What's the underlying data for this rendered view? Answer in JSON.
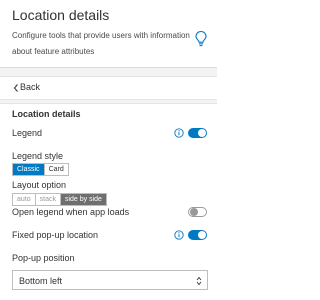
{
  "header": {
    "title": "Location details",
    "description": "Configure tools that provide users with information about feature attributes",
    "help_icon": "lightbulb-icon"
  },
  "nav": {
    "back_label": "Back",
    "back_icon": "chevron-left-icon"
  },
  "section": {
    "title": "Location details",
    "legend": {
      "label": "Legend",
      "enabled": true,
      "info_icon": "info-icon"
    },
    "legend_style": {
      "label": "Legend style",
      "options": [
        "Classic",
        "Card"
      ],
      "selected": "Classic"
    },
    "layout_option": {
      "label": "Layout option",
      "options": [
        "auto",
        "stack",
        "side by side"
      ],
      "selected": "side by side"
    },
    "open_legend": {
      "label": "Open legend when app loads",
      "enabled": false
    },
    "fixed_popup": {
      "label": "Fixed pop-up location",
      "enabled": true,
      "info_icon": "info-icon"
    },
    "popup_position": {
      "label": "Pop-up position",
      "value": "Bottom left",
      "icon": "select-arrows-icon"
    }
  },
  "colors": {
    "accent": "#007ac2",
    "selected_gray": "#6f6f6f",
    "background_gray": "#f3f3f3"
  }
}
